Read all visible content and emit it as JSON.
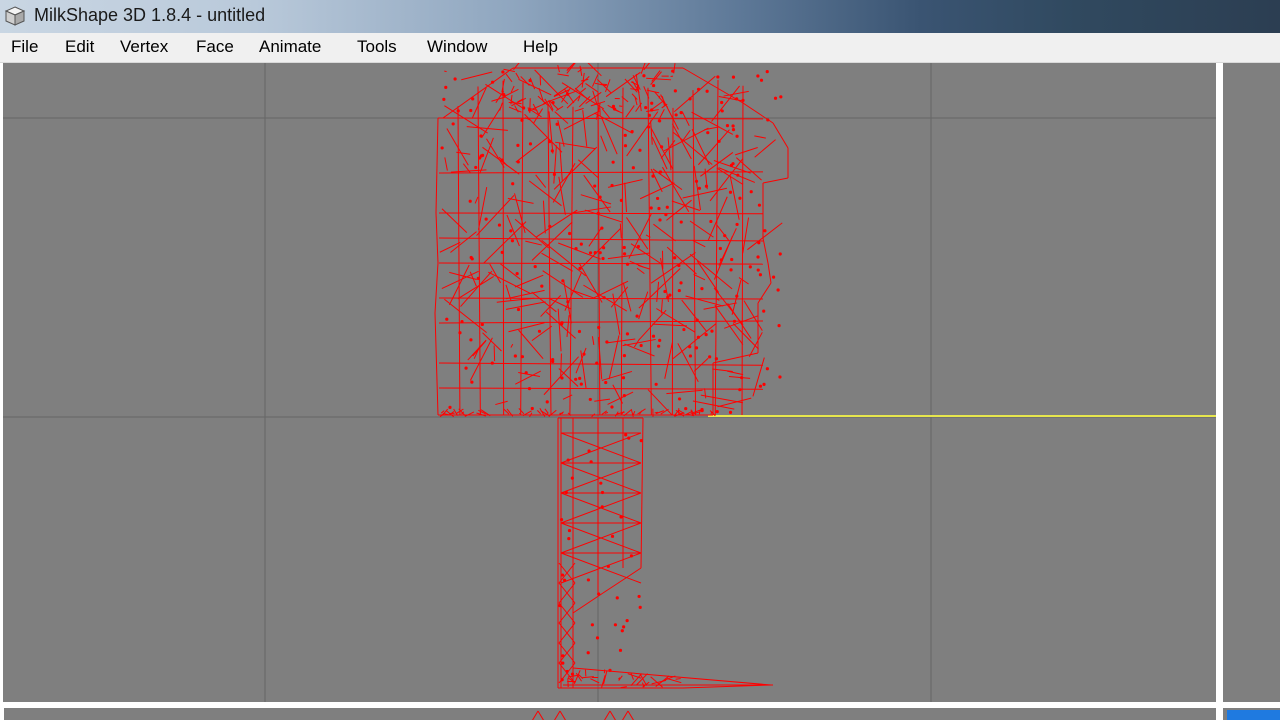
{
  "window": {
    "title": "MilkShape 3D 1.8.4 - untitled",
    "icon": "milkshape-cube-icon"
  },
  "menubar": {
    "items": [
      "File",
      "Edit",
      "Vertex",
      "Face",
      "Animate",
      "Tools",
      "Window",
      "Help"
    ]
  },
  "viewport": {
    "background_color": "#7f7f7f",
    "grid_color": "#666666",
    "axis_color": "#e6e64d",
    "mesh_color": "#ff0000",
    "content": "red wireframe mesh"
  },
  "colors": {
    "menubar_bg": "#f0f0f0",
    "accent": "#1f7ae0"
  }
}
